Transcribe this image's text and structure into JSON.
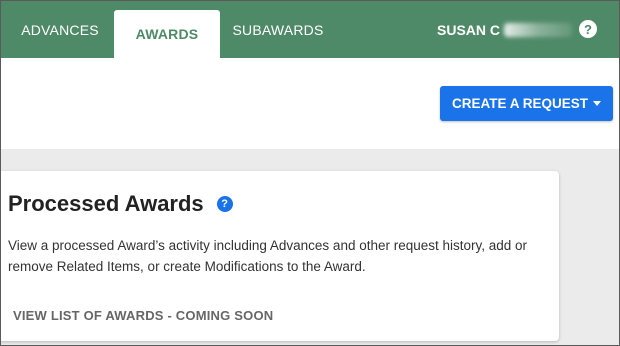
{
  "nav": {
    "tabs": [
      {
        "label": "ADVANCES"
      },
      {
        "label": "AWARDS"
      },
      {
        "label": "SUBAWARDS"
      }
    ],
    "user_name": "SUSAN C",
    "help_glyph": "?"
  },
  "actions": {
    "create_label": "CREATE A REQUEST"
  },
  "card": {
    "title": "Processed Awards",
    "help_glyph": "?",
    "description": "View a processed Award’s activity including Advances and other request history, add or remove Related Items, or create Modifications to the Award.",
    "link_label": "VIEW LIST OF AWARDS - COMING SOON"
  },
  "colors": {
    "nav_bg": "#4f8a68",
    "primary": "#1a73e8",
    "page_bg": "#ebebeb"
  },
  "icons": {
    "top_help": "help-circle-icon",
    "card_help": "help-circle-icon",
    "dropdown": "caret-down-icon"
  }
}
